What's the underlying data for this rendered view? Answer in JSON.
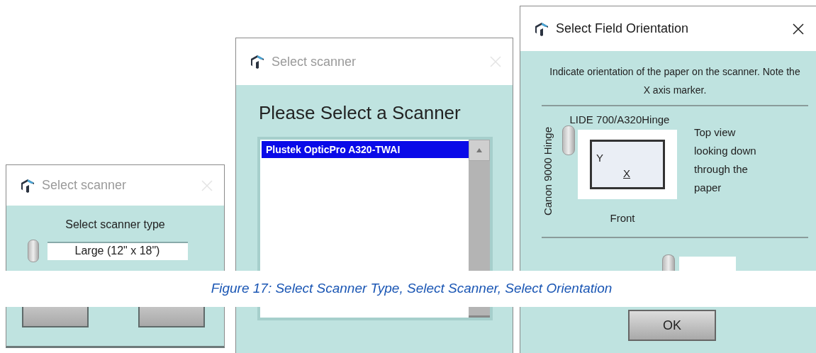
{
  "dialogs": [
    {
      "kind": "scanner_type",
      "title": "Select scanner",
      "active": false,
      "prompt": "Select scanner type",
      "value": "Large (12\" x 18\")"
    },
    {
      "kind": "scanner_list",
      "title": "Select scanner",
      "active": false,
      "heading": "Please Select a Scanner",
      "items": [
        {
          "label": "Plustek OpticPro A320-TWAI",
          "selected": true
        }
      ]
    },
    {
      "kind": "orientation",
      "title": "Select Field Orientation",
      "active": true,
      "instructions": "Indicate orientation of the paper on the scanner.  Note the X axis marker.",
      "side_label": "Canon 9000 Hinge",
      "top_label": "LIDE 700/A320Hinge",
      "y_label": "Y",
      "x_label": "X",
      "note": "Top view looking down through the paper",
      "bottom_label": "Front",
      "button": "OK"
    }
  ],
  "caption": "Figure 17: Select Scanner Type, Select Scanner, Select Orientation"
}
